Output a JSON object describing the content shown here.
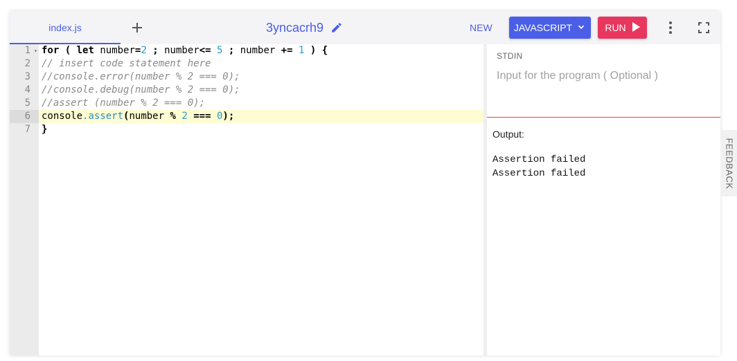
{
  "tabs": {
    "file_tab": "index.js",
    "add_icon": "plus-icon"
  },
  "project": {
    "title": "3yncacrh9",
    "edit_icon": "pencil-icon"
  },
  "toolbar": {
    "new_label": "NEW",
    "language_label": "JAVASCRIPT",
    "run_label": "RUN",
    "more_icon": "more-vertical-icon",
    "fullscreen_icon": "fullscreen-icon"
  },
  "colors": {
    "accent": "#4a5ee8",
    "run": "#e8375f",
    "active_line": "#fdfcd2",
    "divider_red": "#e0463e"
  },
  "editor": {
    "active_line": 6,
    "lines": [
      {
        "n": "1",
        "text": "for ( let number=2 ; number<= 5 ; number += 1 ) {"
      },
      {
        "n": "2",
        "text": "// insert code statement here"
      },
      {
        "n": "3",
        "text": "//console.error(number % 2 === 0);"
      },
      {
        "n": "4",
        "text": "//console.debug(number % 2 === 0);"
      },
      {
        "n": "5",
        "text": "//assert (number % 2 === 0);"
      },
      {
        "n": "6",
        "text": "console.assert(number % 2 === 0);"
      },
      {
        "n": "7",
        "text": "}"
      }
    ]
  },
  "stdin": {
    "label": "STDIN",
    "placeholder": "Input for the program ( Optional )"
  },
  "output": {
    "label": "Output:",
    "lines": [
      "Assertion failed",
      "Assertion failed"
    ]
  },
  "feedback": {
    "label": "FEEDBACK"
  }
}
